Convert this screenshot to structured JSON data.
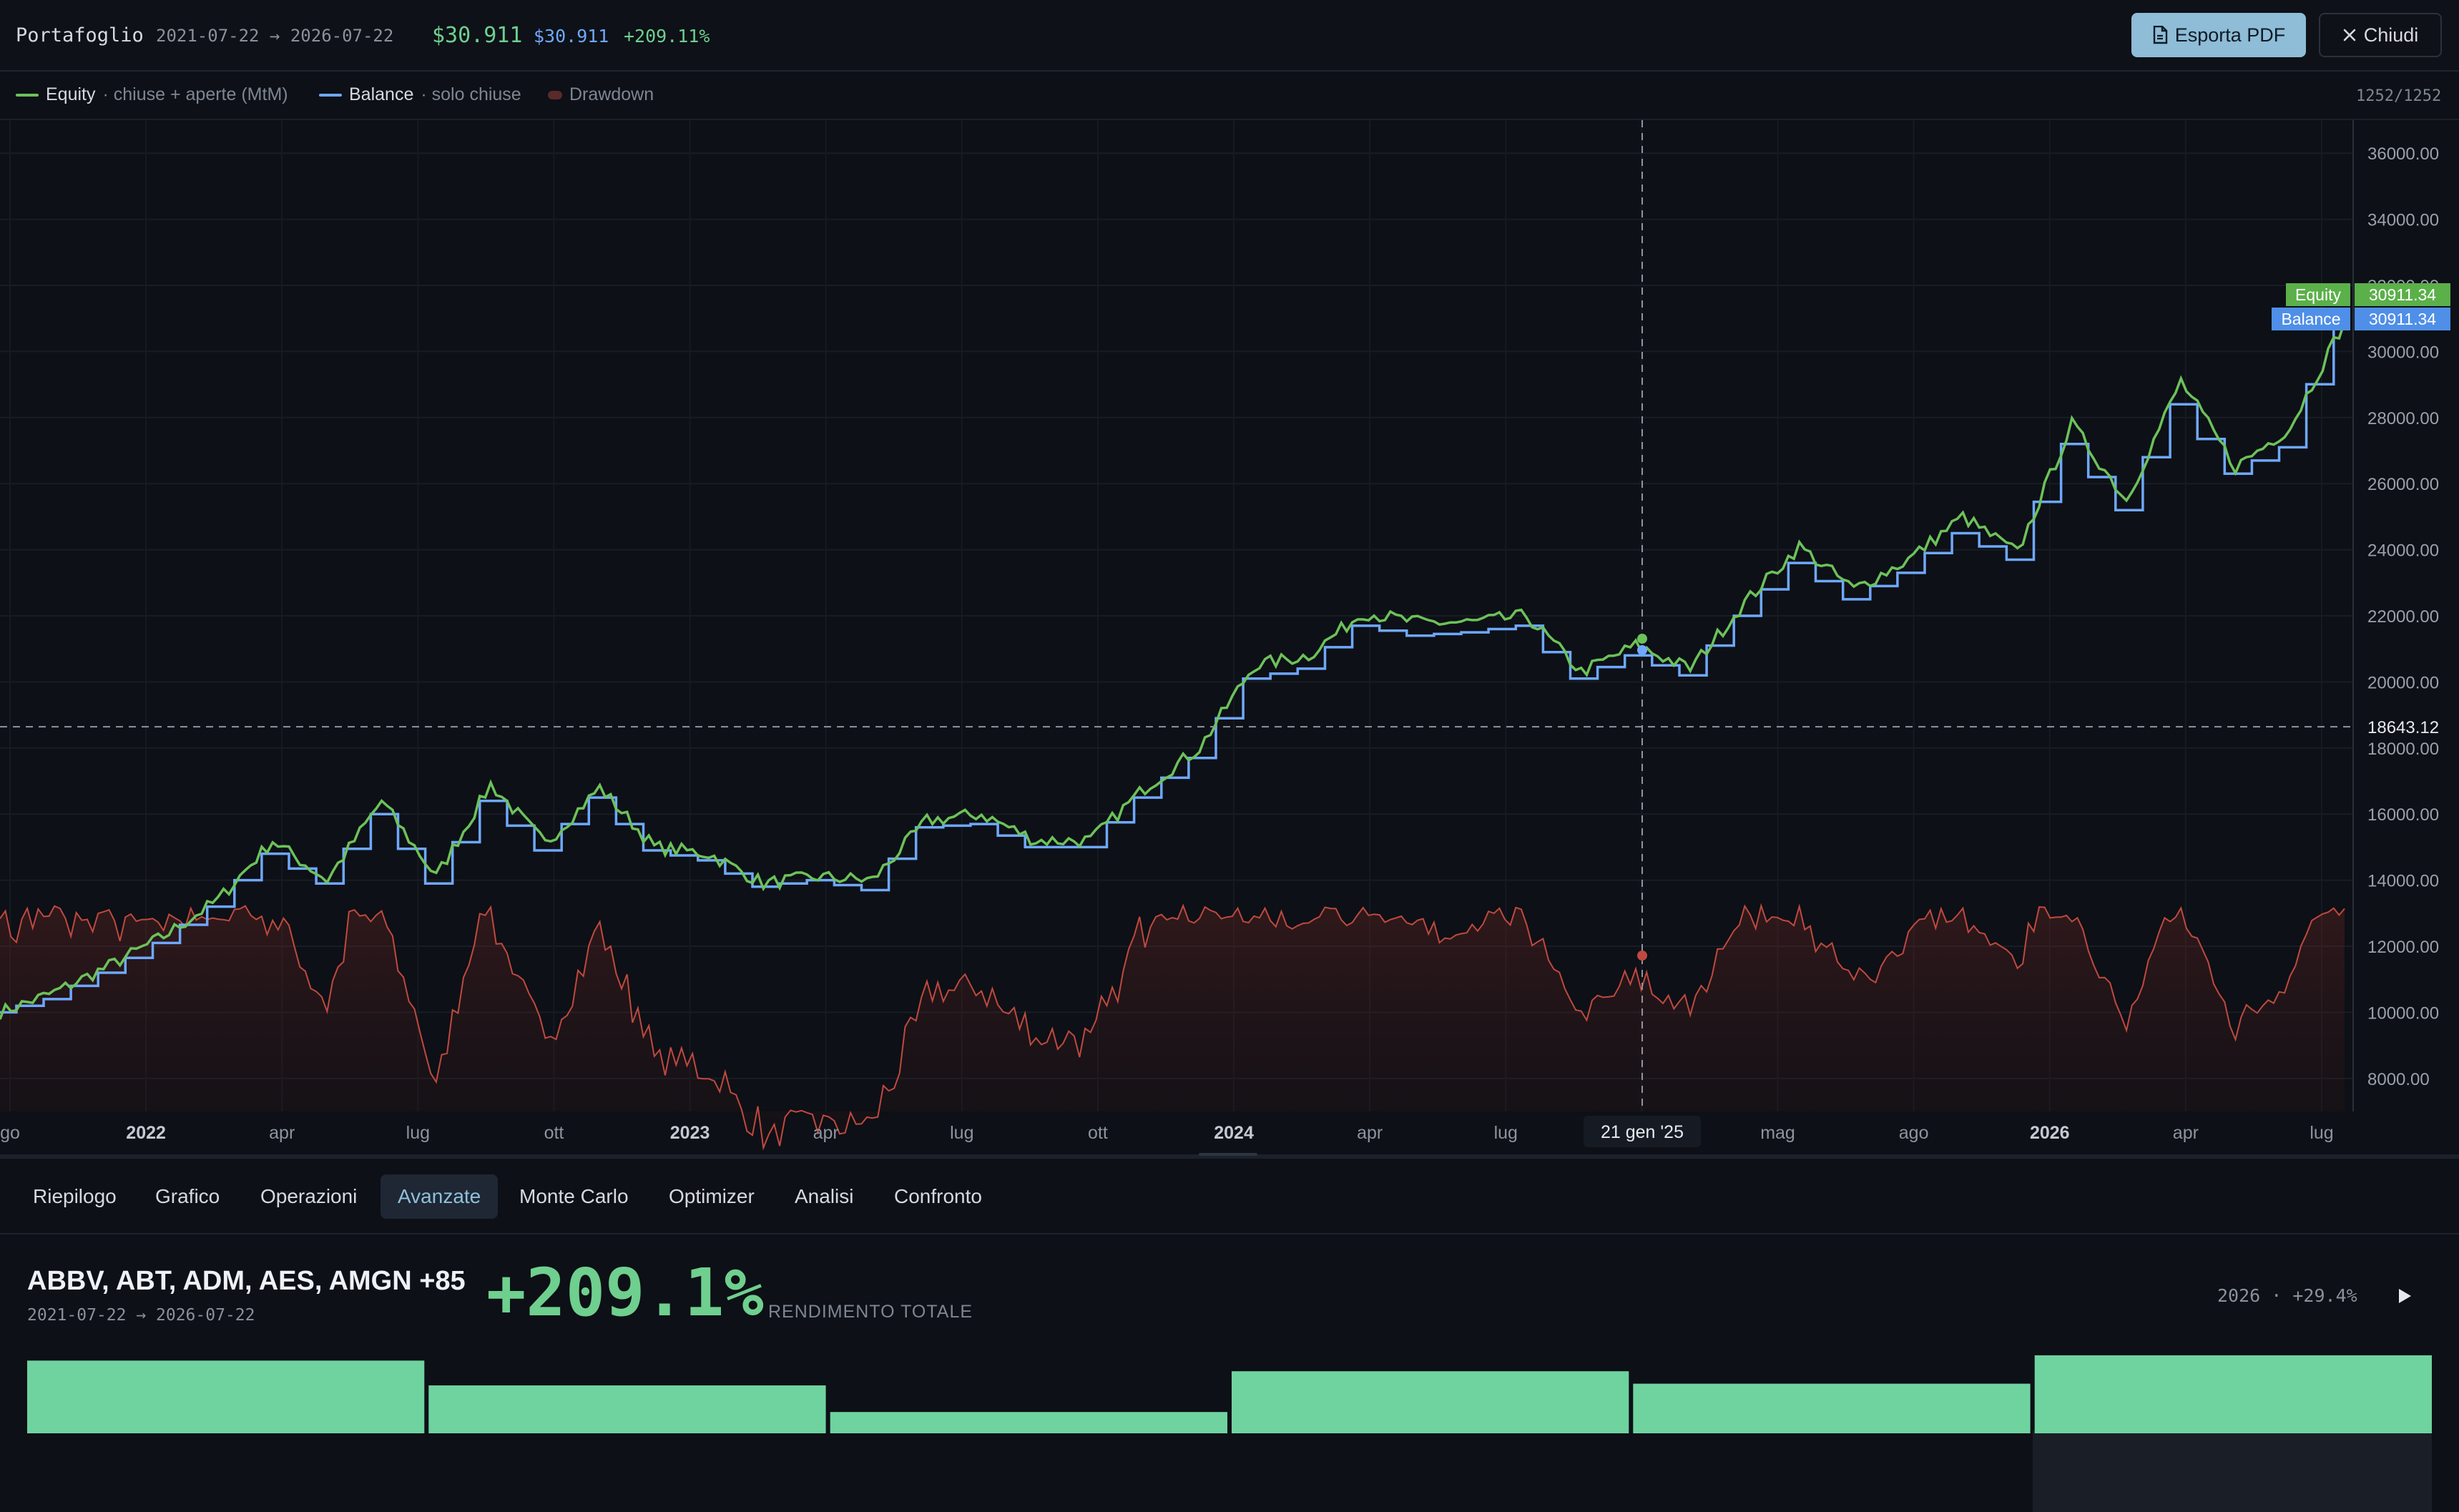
{
  "header": {
    "title": "Portafoglio",
    "range": "2021-07-22 → 2026-07-22",
    "equity_value": "$30.911",
    "balance_value": "$30.911",
    "total_return": "+209.11%",
    "export_label": "Esporta PDF",
    "close_label": "Chiudi"
  },
  "legend": {
    "equity": {
      "name": "Equity",
      "desc": "· chiuse + aperte (MtM)",
      "color": "#6cc25a"
    },
    "balance": {
      "name": "Balance",
      "desc": "· solo chiuse",
      "color": "#6fa8ff"
    },
    "drawdown": {
      "name": "Drawdown",
      "color": "#c0493f"
    },
    "counter": "1252/1252"
  },
  "chart_data": {
    "type": "line",
    "y_ticks": [
      "36000.00",
      "34000.00",
      "32000.00",
      "30000.00",
      "28000.00",
      "26000.00",
      "24000.00",
      "22000.00",
      "20000.00",
      "18000.00",
      "16000.00",
      "14000.00",
      "12000.00",
      "10000.00",
      "8000.00"
    ],
    "ylim": [
      7000,
      37000
    ],
    "x_ticks": [
      {
        "label": "go",
        "year": false
      },
      {
        "label": "2022",
        "year": true
      },
      {
        "label": "apr",
        "year": false
      },
      {
        "label": "lug",
        "year": false
      },
      {
        "label": "ott",
        "year": false
      },
      {
        "label": "2023",
        "year": true
      },
      {
        "label": "apr",
        "year": false
      },
      {
        "label": "lug",
        "year": false
      },
      {
        "label": "ott",
        "year": false
      },
      {
        "label": "2024",
        "year": true
      },
      {
        "label": "apr",
        "year": false
      },
      {
        "label": "lug",
        "year": false
      },
      {
        "label": "ott",
        "year": false
      },
      {
        "label": "mag",
        "year": false
      },
      {
        "label": "ago",
        "year": false
      },
      {
        "label": "2026",
        "year": true
      },
      {
        "label": "apr",
        "year": false
      },
      {
        "label": "lug",
        "year": false
      }
    ],
    "crosshair": {
      "date_label": "21 gen '25",
      "value_label": "18643.12"
    },
    "last_values": {
      "equity_label": "Equity",
      "equity": "30911.34",
      "balance_label": "Balance",
      "balance": "30911.34"
    },
    "series": [
      {
        "name": "Equity",
        "values": [
          10000,
          10600,
          11400,
          12300,
          13400,
          15200,
          14000,
          16400,
          14100,
          16900,
          15100,
          16800,
          15000,
          14800,
          13900,
          14100,
          14000,
          15800,
          16000,
          15200,
          15200,
          16800,
          18000,
          20500,
          20800,
          22100,
          21800,
          21800,
          22000,
          20300,
          21100,
          20400,
          22400,
          24100,
          22800,
          23700,
          25000,
          23900,
          27800,
          25500,
          29100,
          26500,
          27700,
          30911
        ]
      },
      {
        "name": "Balance",
        "values": [
          10000,
          10400,
          11200,
          12100,
          13200,
          14800,
          13900,
          16000,
          13900,
          16400,
          14900,
          16500,
          14900,
          14600,
          13800,
          14000,
          13700,
          15600,
          15700,
          15000,
          15000,
          16500,
          17700,
          20100,
          20400,
          21700,
          21400,
          21500,
          21700,
          20100,
          20800,
          20200,
          22000,
          23600,
          22500,
          23300,
          24500,
          23700,
          27200,
          25200,
          28400,
          26300,
          27100,
          30911
        ]
      }
    ]
  },
  "tabs": [
    "Riepilogo",
    "Grafico",
    "Operazioni",
    "Avanzate",
    "Monte Carlo",
    "Optimizer",
    "Analisi",
    "Confronto"
  ],
  "active_tab": "Avanzate",
  "summary": {
    "tickers": "ABBV, ABT, ADM, AES, AMGN +85",
    "range": "2021-07-22 → 2026-07-22",
    "total_return": "+209.1%",
    "return_label": "RENDIMENTO TOTALE",
    "year_stat": "2026 · +29.4%"
  },
  "annual_bars": {
    "color": "#6fd3a0",
    "values": [
      0.82,
      0.54,
      0.24,
      0.7,
      0.56,
      0.88
    ]
  }
}
